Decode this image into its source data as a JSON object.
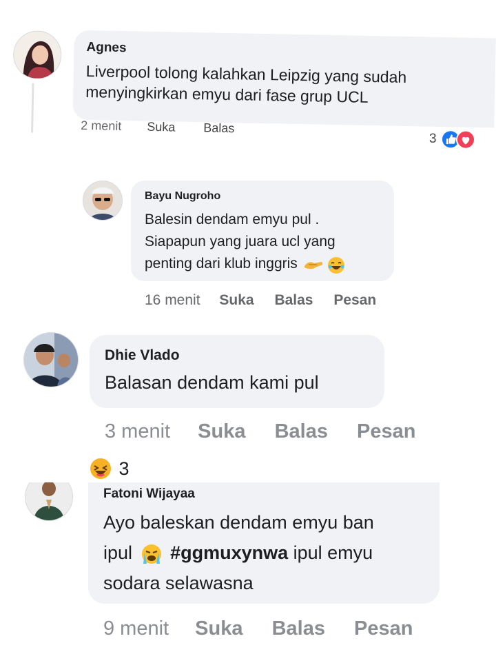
{
  "comments": [
    {
      "author": "Agnes",
      "text_lines": [
        "Liverpool tolong kalahkan Leipzig yang sudah",
        "menyingkirkan emyu dari fase grup UCL"
      ],
      "time": "2 menit",
      "like_label": "Suka",
      "reply_label": "Balas",
      "reaction_count": "3",
      "reaction_icons": [
        "like-icon",
        "love-icon"
      ]
    },
    {
      "author": "Bayu Nugroho",
      "text_lines": [
        "Balesin dendam emyu pul  .",
        "Siapapun yang juara ucl yang",
        "penting dari klub inggris"
      ],
      "text_emojis": [
        "handshake-icon",
        "laughing-tears-icon"
      ],
      "time": "16 menit",
      "like_label": "Suka",
      "reply_label": "Balas",
      "message_label": "Pesan"
    },
    {
      "author": "Dhie Vlado",
      "text_lines": [
        "Balasan dendam kami pul"
      ],
      "time": "3 menit",
      "like_label": "Suka",
      "reply_label": "Balas",
      "message_label": "Pesan",
      "reaction_count": "3",
      "reaction_icons": [
        "haha-icon"
      ]
    },
    {
      "author": "Fatoni Wijayaa",
      "text_line1": "Ayo baleskan dendam emyu ban",
      "text_line2_a": "ipul",
      "text_line2_hashtag": "#ggmuxynwa",
      "text_line2_b": "ipul emyu",
      "text_line3": "sodara selawasna",
      "text_emojis": [
        "crying-icon"
      ],
      "time": "9 menit",
      "like_label": "Suka",
      "reply_label": "Balas",
      "message_label": "Pesan"
    }
  ],
  "colors": {
    "bubble": "#f0f2f5",
    "text": "#1c1e21",
    "meta": "#65676b",
    "like_blue": "#1877f2",
    "love_red": "#f33e58",
    "haha_yellow": "#f7b125"
  }
}
